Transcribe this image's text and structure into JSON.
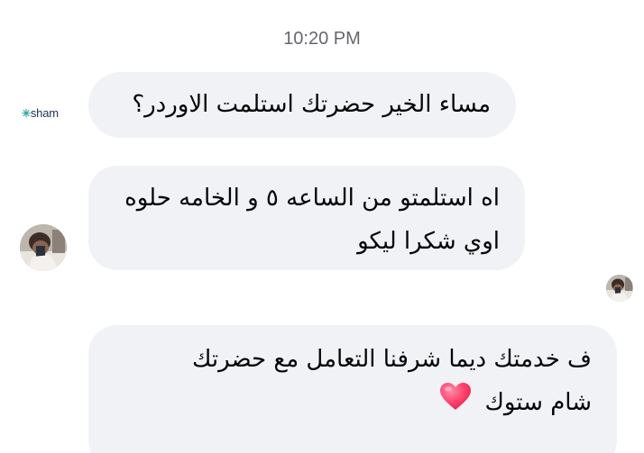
{
  "timestamp": "10:20 PM",
  "page_logo": {
    "text": "sham"
  },
  "messages": [
    {
      "text": "مساء الخير حضرتك استلمت الاوردر؟"
    },
    {
      "line1": "اه استلمتو من الساعه ٥ و الخامه حلوه",
      "line2": "اوي شكرا ليكو"
    },
    {
      "line1": "ف خدمتك ديما شرفنا التعامل مع حضرتك",
      "line2": "شام ستوك",
      "emoji": "red-heart-icon"
    }
  ],
  "colors": {
    "bubble_bg": "#f0f2f5",
    "timestamp": "#65676b",
    "heart": "#ff3f6c"
  }
}
